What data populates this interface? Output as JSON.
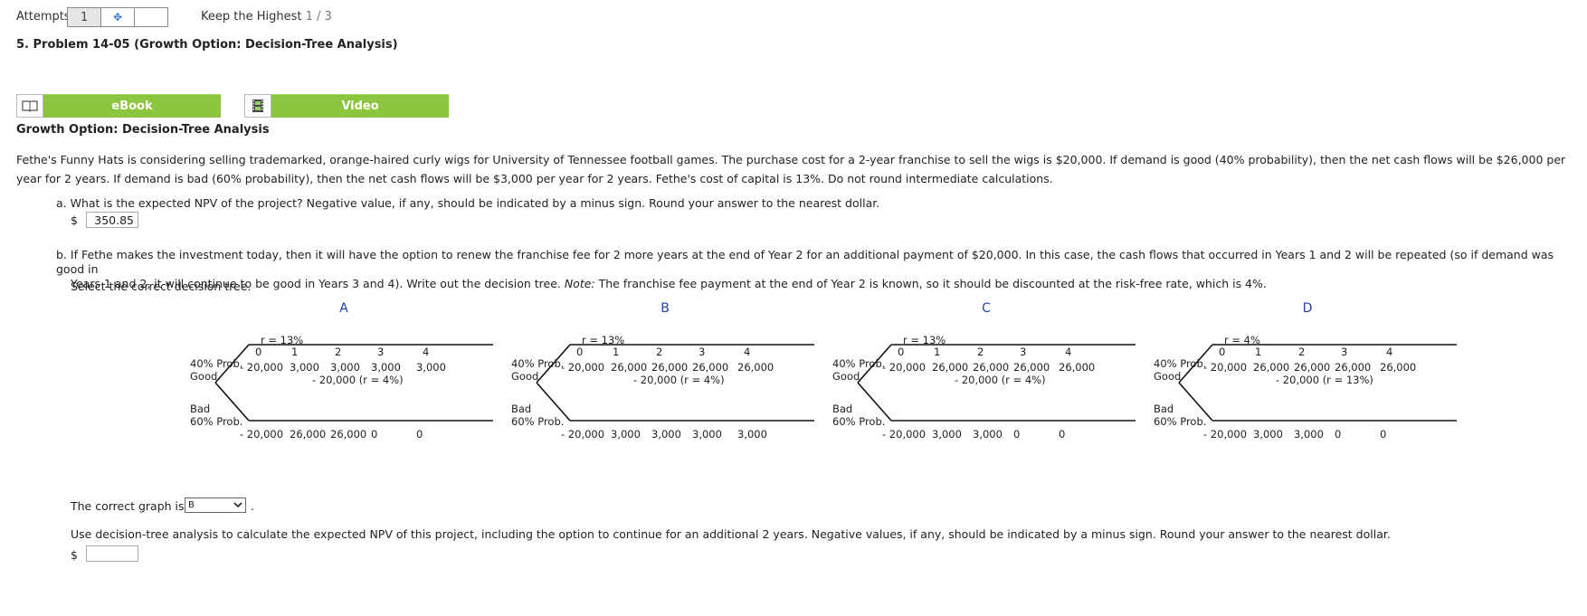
{
  "header": {
    "attempts_label": "Attempts",
    "attempts_value": "1",
    "keep_label": "Keep the Highest",
    "keep_value": "1 / 3"
  },
  "problem_title": "5.  Problem 14-05 (Growth Option: Decision-Tree Analysis)",
  "buttons": {
    "ebook": "eBook",
    "video": "Video"
  },
  "section_title": "Growth Option: Decision-Tree Analysis",
  "intro": "Fethe's Funny Hats is considering selling trademarked, orange-haired curly wigs for University of Tennessee football games. The purchase cost for a 2-year franchise to sell the wigs is $20,000. If demand is good (40% probability), then the net cash flows will be $26,000 per year for 2 years. If demand is bad (60% probability), then the net cash flows will be $3,000 per year for 2 years. Fethe's cost of capital is 13%. Do not round intermediate calculations.",
  "part_a": {
    "question": "a. What is the expected NPV of the project? Negative value, if any, should be indicated by a minus sign. Round your answer to the nearest dollar.",
    "currency": "$",
    "answer": "350.85"
  },
  "part_b": {
    "question_line1": "b. If Fethe makes the investment today, then it will have the option to renew the franchise fee for 2 more years at the end of Year 2 for an additional payment of $20,000. In this case, the cash flows that occurred in Years 1 and 2 will be repeated (so if demand was good in",
    "question_line2_pre": "Years 1 and 2, it will continue to be good in Years 3 and 4). Write out the decision tree. ",
    "question_note": "Note:",
    "question_line2_post": " The franchise fee payment at the end of Year 2 is known, so it should be discounted at the risk-free rate, which is 4%.",
    "select_prompt": "Select the correct decision tree."
  },
  "trees": [
    {
      "letter": "A",
      "rate": "r = 13%",
      "years": [
        "0",
        "1",
        "2",
        "3",
        "4"
      ],
      "good_prob": "40% Prob.",
      "good_label": "Good",
      "bad_label": "Bad",
      "bad_prob": "60% Prob.",
      "good_row": [
        "- 20,000",
        "3,000",
        "3,000",
        "3,000",
        "3,000"
      ],
      "good_sub": "- 20,000 (r = 4%)",
      "bad_row": [
        "- 20,000",
        "26,000",
        "26,000",
        "0",
        "0"
      ]
    },
    {
      "letter": "B",
      "rate": "r = 13%",
      "years": [
        "0",
        "1",
        "2",
        "3",
        "4"
      ],
      "good_prob": "40% Prob.",
      "good_label": "Good",
      "bad_label": "Bad",
      "bad_prob": "60% Prob.",
      "good_row": [
        "- 20,000",
        "26,000",
        "26,000",
        "26,000",
        "26,000"
      ],
      "good_sub": "- 20,000 (r = 4%)",
      "bad_row": [
        "- 20,000",
        "3,000",
        "3,000",
        "3,000",
        "3,000"
      ]
    },
    {
      "letter": "C",
      "rate": "r = 13%",
      "years": [
        "0",
        "1",
        "2",
        "3",
        "4"
      ],
      "good_prob": "40% Prob.",
      "good_label": "Good",
      "bad_label": "Bad",
      "bad_prob": "60% Prob.",
      "good_row": [
        "- 20,000",
        "26,000",
        "26,000",
        "26,000",
        "26,000"
      ],
      "good_sub": "- 20,000 (r = 4%)",
      "bad_row": [
        "- 20,000",
        "3,000",
        "3,000",
        "0",
        "0"
      ]
    },
    {
      "letter": "D",
      "rate": "r = 4%",
      "years": [
        "0",
        "1",
        "2",
        "3",
        "4"
      ],
      "good_prob": "40% Prob.",
      "good_label": "Good",
      "bad_label": "Bad",
      "bad_prob": "60% Prob.",
      "good_row": [
        "- 20,000",
        "26,000",
        "26,000",
        "26,000",
        "26,000"
      ],
      "good_sub": "- 20,000 (r = 13%)",
      "bad_row": [
        "- 20,000",
        "3,000",
        "3,000",
        "0",
        "0"
      ]
    }
  ],
  "graph_select": {
    "label": "The correct graph is",
    "value": "B",
    "after": "."
  },
  "part_c": {
    "question": "Use decision-tree analysis to calculate the expected NPV of this project, including the option to continue for an additional 2 years. Negative values, if any, should be indicated by a minus sign. Round your answer to the nearest dollar.",
    "currency": "$",
    "answer": ""
  }
}
